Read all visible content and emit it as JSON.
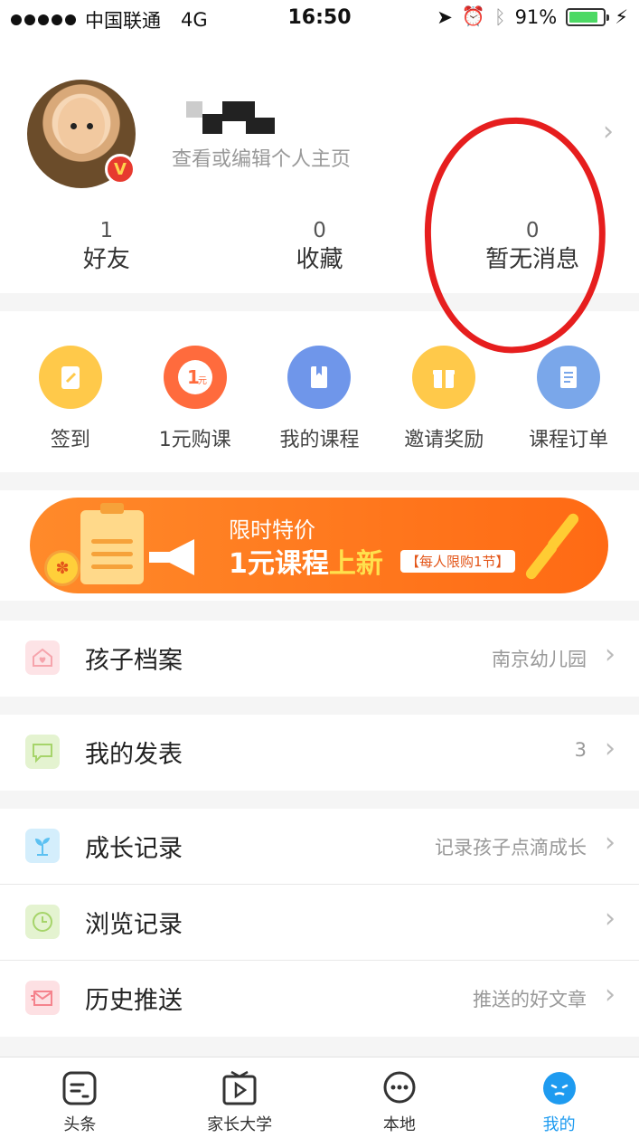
{
  "status_bar": {
    "carrier": "中国联通",
    "network": "4G",
    "time": "16:50",
    "battery": "91%",
    "battery_level": 0.91
  },
  "profile": {
    "subtitle": "查看或编辑个人主页",
    "stats": [
      {
        "count": "1",
        "label": "好友"
      },
      {
        "count": "0",
        "label": "收藏"
      },
      {
        "count": "0",
        "label": "暂无消息"
      }
    ]
  },
  "quick_actions": [
    {
      "label": "签到",
      "icon": "clipboard-pen-icon",
      "color": "#ffc94a"
    },
    {
      "label": "1元购课",
      "icon": "one-yuan-coin-icon",
      "color": "#ff6b3d"
    },
    {
      "label": "我的课程",
      "icon": "book-icon",
      "color": "#6f96ea"
    },
    {
      "label": "邀请奖励",
      "icon": "gift-icon",
      "color": "#ffc94a"
    },
    {
      "label": "课程订单",
      "icon": "document-icon",
      "color": "#7aa7ea"
    }
  ],
  "banner": {
    "line1": "限时特价",
    "line2_part1": "1元课程",
    "line2_highlight": "上新",
    "tag": "【每人限购1节】"
  },
  "menu": [
    {
      "label": "孩子档案",
      "value": "南京幼儿园",
      "icon": "house-heart-icon",
      "color": "#f6a4ac"
    },
    {
      "label": "我的发表",
      "value": "3",
      "icon": "chat-bubble-icon",
      "color": "#a6d46a"
    },
    {
      "label": "成长记录",
      "value": "记录孩子点滴成长",
      "icon": "sprout-icon",
      "color": "#5cc1f2"
    },
    {
      "label": "浏览记录",
      "value": "",
      "icon": "clock-icon",
      "color": "#a6d46a"
    },
    {
      "label": "历史推送",
      "value": "推送的好文章",
      "icon": "envelope-icon",
      "color": "#f5838d"
    }
  ],
  "tab_bar": [
    {
      "label": "头条",
      "icon": "news-icon"
    },
    {
      "label": "家长大学",
      "icon": "video-play-icon"
    },
    {
      "label": "本地",
      "icon": "chat-dots-icon"
    },
    {
      "label": "我的",
      "icon": "profile-face-icon",
      "active": true
    }
  ],
  "accent_color": "#1e9bf0"
}
